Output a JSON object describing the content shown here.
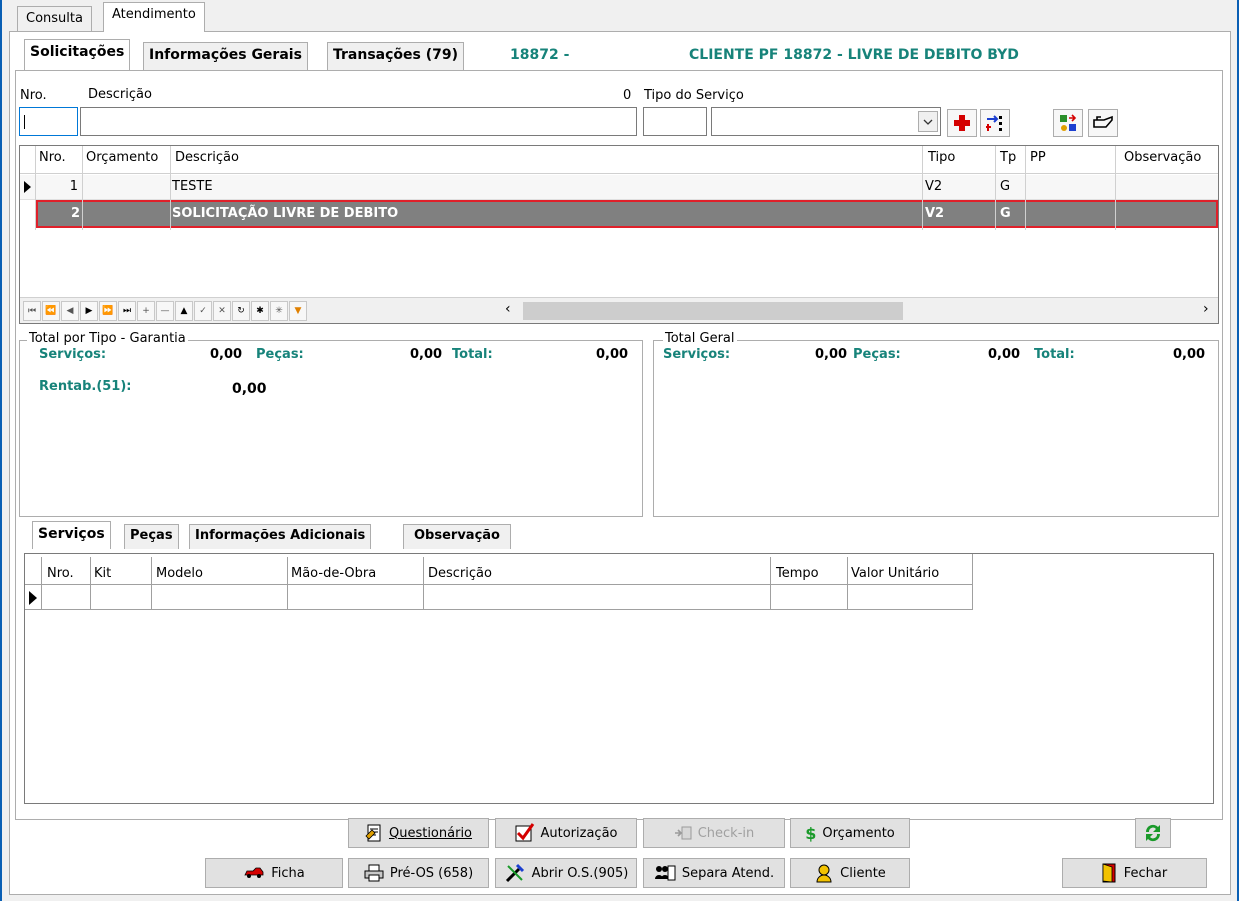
{
  "top_tabs": [
    "Consulta",
    "Atendimento"
  ],
  "inner_tabs": [
    "Solicitações",
    "Informações Gerais",
    "Transações (79)"
  ],
  "header": {
    "code": "18872 -",
    "client": "CLIENTE PF 18872 - LIVRE DE DEBITO BYD"
  },
  "form": {
    "nro_label": "Nro.",
    "descricao_label": "Descrição",
    "count_value": "0",
    "tipo_servico_label": "Tipo do Serviço",
    "nro_value": "",
    "descricao_value": ""
  },
  "solicitacoes_grid": {
    "columns": [
      "Nro.",
      "Orçamento",
      "Descrição",
      "Tipo",
      "Tp",
      "PP",
      "Observação"
    ],
    "rows": [
      {
        "nro": "1",
        "orcamento": "",
        "descricao": "TESTE",
        "tipo": "V2",
        "tp": "G",
        "pp": "",
        "obs": ""
      },
      {
        "nro": "2",
        "orcamento": "",
        "descricao": "SOLICITAÇÃO LIVRE DE DEBITO",
        "tipo": "V2",
        "tp": "G",
        "pp": "",
        "obs": ""
      }
    ]
  },
  "total_garantia": {
    "title": "Total por Tipo - Garantia",
    "servicos_label": "Serviços:",
    "servicos_value": "0,00",
    "pecas_label": "Peças:",
    "pecas_value": "0,00",
    "total_label": "Total:",
    "total_value": "0,00",
    "rentab_label": "Rentab.(51):",
    "rentab_value": "0,00"
  },
  "total_geral": {
    "title": "Total Geral",
    "servicos_label": "Serviços:",
    "servicos_value": "0,00",
    "pecas_label": "Peças:",
    "pecas_value": "0,00",
    "total_label": "Total:",
    "total_value": "0,00"
  },
  "bottom_tabs": [
    "Serviços",
    "Peças",
    "Informações Adicionais",
    "Observação"
  ],
  "servicos_grid": {
    "columns": [
      "Nro.",
      "Kit",
      "Modelo",
      "Mão-de-Obra",
      "Descrição",
      "Tempo",
      "Valor Unitário"
    ]
  },
  "buttons": {
    "questionario": "Questionário",
    "autorizacao": "Autorização",
    "checkin": "Check-in",
    "orcamento": "Orçamento",
    "ficha": "Ficha",
    "preos": "Pré-OS (658)",
    "abrir_os": "Abrir O.S.(905)",
    "separa": "Separa Atend.",
    "cliente": "Cliente",
    "fechar": "Fechar"
  },
  "colors": {
    "teal": "#17837a",
    "selected_row": "#808080",
    "highlight_border": "#e0202a"
  }
}
